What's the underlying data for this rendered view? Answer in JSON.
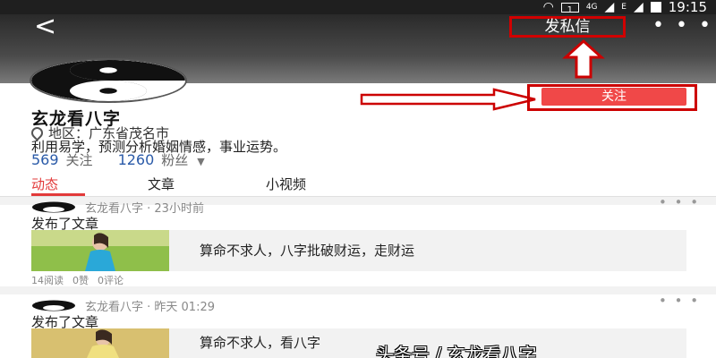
{
  "status_bar": {
    "time": "19:15",
    "sim": "1",
    "network": "4G",
    "roaming": "E"
  },
  "header": {
    "send_message": "发私信",
    "more": "• • •",
    "back": "<"
  },
  "profile": {
    "name": "玄龙看八字",
    "region": "地区：广东省茂名市",
    "bio": "利用易学，预测分析婚姻情感，事业运势。",
    "following_count": "569",
    "following_label": "关注",
    "fans_count": "1260",
    "fans_label": "粉丝",
    "follow_button": "关注"
  },
  "tabs": [
    {
      "label": "动态",
      "active": true
    },
    {
      "label": "文章",
      "active": false
    },
    {
      "label": "小视频",
      "active": false
    }
  ],
  "posts": [
    {
      "author_time": "玄龙看八字 · 23小时前",
      "action": "发布了文章",
      "title": "算命不求人，八字批破财运，走财运",
      "reads": "14阅读",
      "likes": "0赞",
      "comments": "0评论"
    },
    {
      "author_time": "玄龙看八字 · 昨天 01:29",
      "action": "发布了文章",
      "title": "算命不求人，看八字"
    }
  ],
  "watermark": "头条号 / 玄龙看八字",
  "colors": {
    "accent": "#e23a3a",
    "link": "#2a5aa8",
    "annotation": "#cc0000"
  }
}
